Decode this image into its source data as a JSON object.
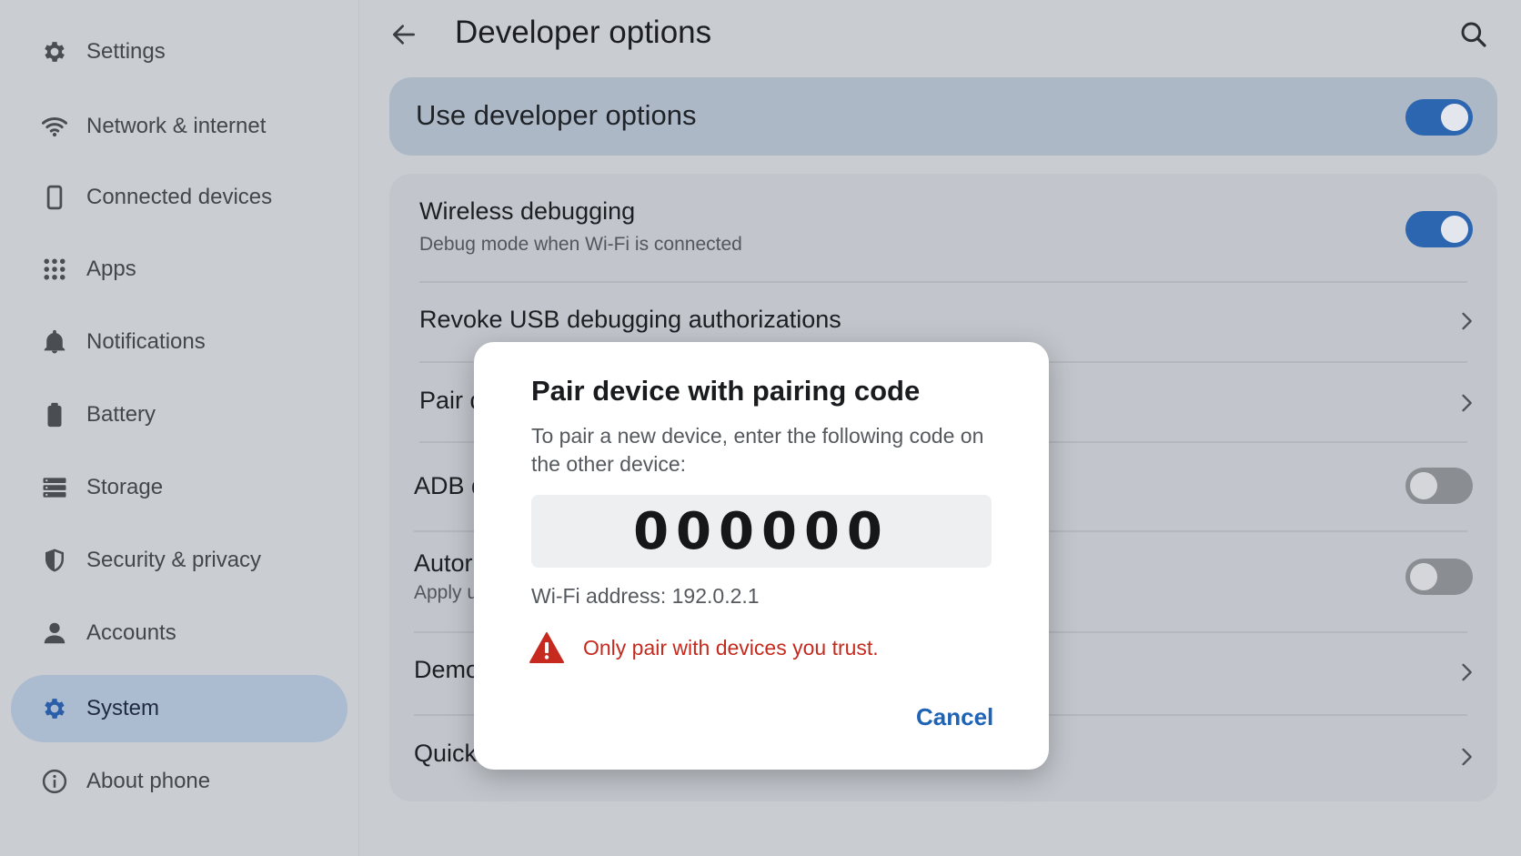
{
  "sidebar": {
    "items": [
      {
        "label": "Settings",
        "icon": "gear-icon"
      },
      {
        "label": "Network & internet",
        "icon": "wifi-icon"
      },
      {
        "label": "Connected devices",
        "icon": "phone-device-icon"
      },
      {
        "label": "Apps",
        "icon": "apps-grid-icon"
      },
      {
        "label": "Notifications",
        "icon": "bell-icon"
      },
      {
        "label": "Battery",
        "icon": "battery-icon"
      },
      {
        "label": "Storage",
        "icon": "storage-icon"
      },
      {
        "label": "Security & privacy",
        "icon": "shield-icon"
      },
      {
        "label": "Accounts",
        "icon": "person-icon"
      },
      {
        "label": "System",
        "icon": "gear-icon",
        "active": true
      },
      {
        "label": "About phone",
        "icon": "info-icon"
      }
    ]
  },
  "header": {
    "title": "Developer options",
    "back_icon": "arrow-back-icon",
    "search_icon": "search-icon"
  },
  "main_toggle": {
    "label": "Use developer options",
    "on": true
  },
  "settings_list": [
    {
      "title": "Wireless debugging",
      "subtitle": "Debug mode when Wi-Fi is connected",
      "control": "toggle",
      "on": true
    },
    {
      "title": "Revoke USB debugging authorizations",
      "control": "chevron"
    },
    {
      "title": "Pair d",
      "control": "chevron"
    },
    {
      "title": "ADB d",
      "control": "toggle",
      "on": false
    },
    {
      "title": "Autor",
      "subtitle": "Apply u",
      "control": "toggle",
      "on": false
    },
    {
      "title": "Demo",
      "control": "chevron"
    },
    {
      "title": "Quick",
      "control": "chevron"
    }
  ],
  "dialog": {
    "title": "Pair device with pairing code",
    "description": "To pair a new device, enter the following code on the other device:",
    "code": "000000",
    "wifi_address": "Wi-Fi address: 192.0.2.1",
    "warning": "Only pair with devices you trust.",
    "warning_icon": "warning-triangle-icon",
    "cancel_label": "Cancel"
  },
  "colors": {
    "accent": "#2c65b0",
    "warning": "#c62a1e",
    "dialog_bg": "#ffffff"
  }
}
